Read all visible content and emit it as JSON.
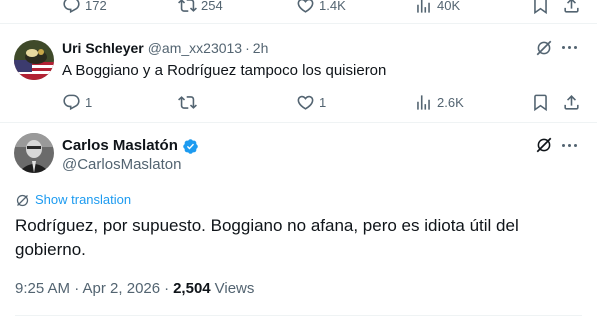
{
  "previous_tweet": {
    "metrics": {
      "replies": "172",
      "reposts": "254",
      "likes": "1.4K",
      "views": "40K"
    }
  },
  "reply_tweet": {
    "display_name": "Uri Schleyer",
    "handle": "@am_xx23013",
    "separator": "·",
    "time": "2h",
    "text": "A Boggiano y a Rodríguez tampoco los quisieron",
    "metrics": {
      "replies": "1",
      "reposts": "",
      "likes": "1",
      "views": "2.6K"
    }
  },
  "main_tweet": {
    "display_name": "Carlos Maslatón",
    "handle": "@CarlosMaslaton",
    "show_translation": "Show translation",
    "text": "Rodríguez, por supuesto. Boggiano no afana, pero es idiota útil del gobierno.",
    "timestamp": "9:25 AM · Apr 2, 2026",
    "dot": "·",
    "views_count": "2,504",
    "views_label": "Views"
  },
  "colors": {
    "text_primary": "#0f1419",
    "text_secondary": "#536471",
    "link": "#1d9bf0",
    "verified": "#1d9bf0",
    "divider": "#eff3f4"
  },
  "icons": [
    "reply-icon",
    "repost-icon",
    "like-icon",
    "views-icon",
    "bookmark-icon",
    "share-icon",
    "grok-icon",
    "more-icon",
    "verified-badge-icon",
    "translate-icon"
  ]
}
